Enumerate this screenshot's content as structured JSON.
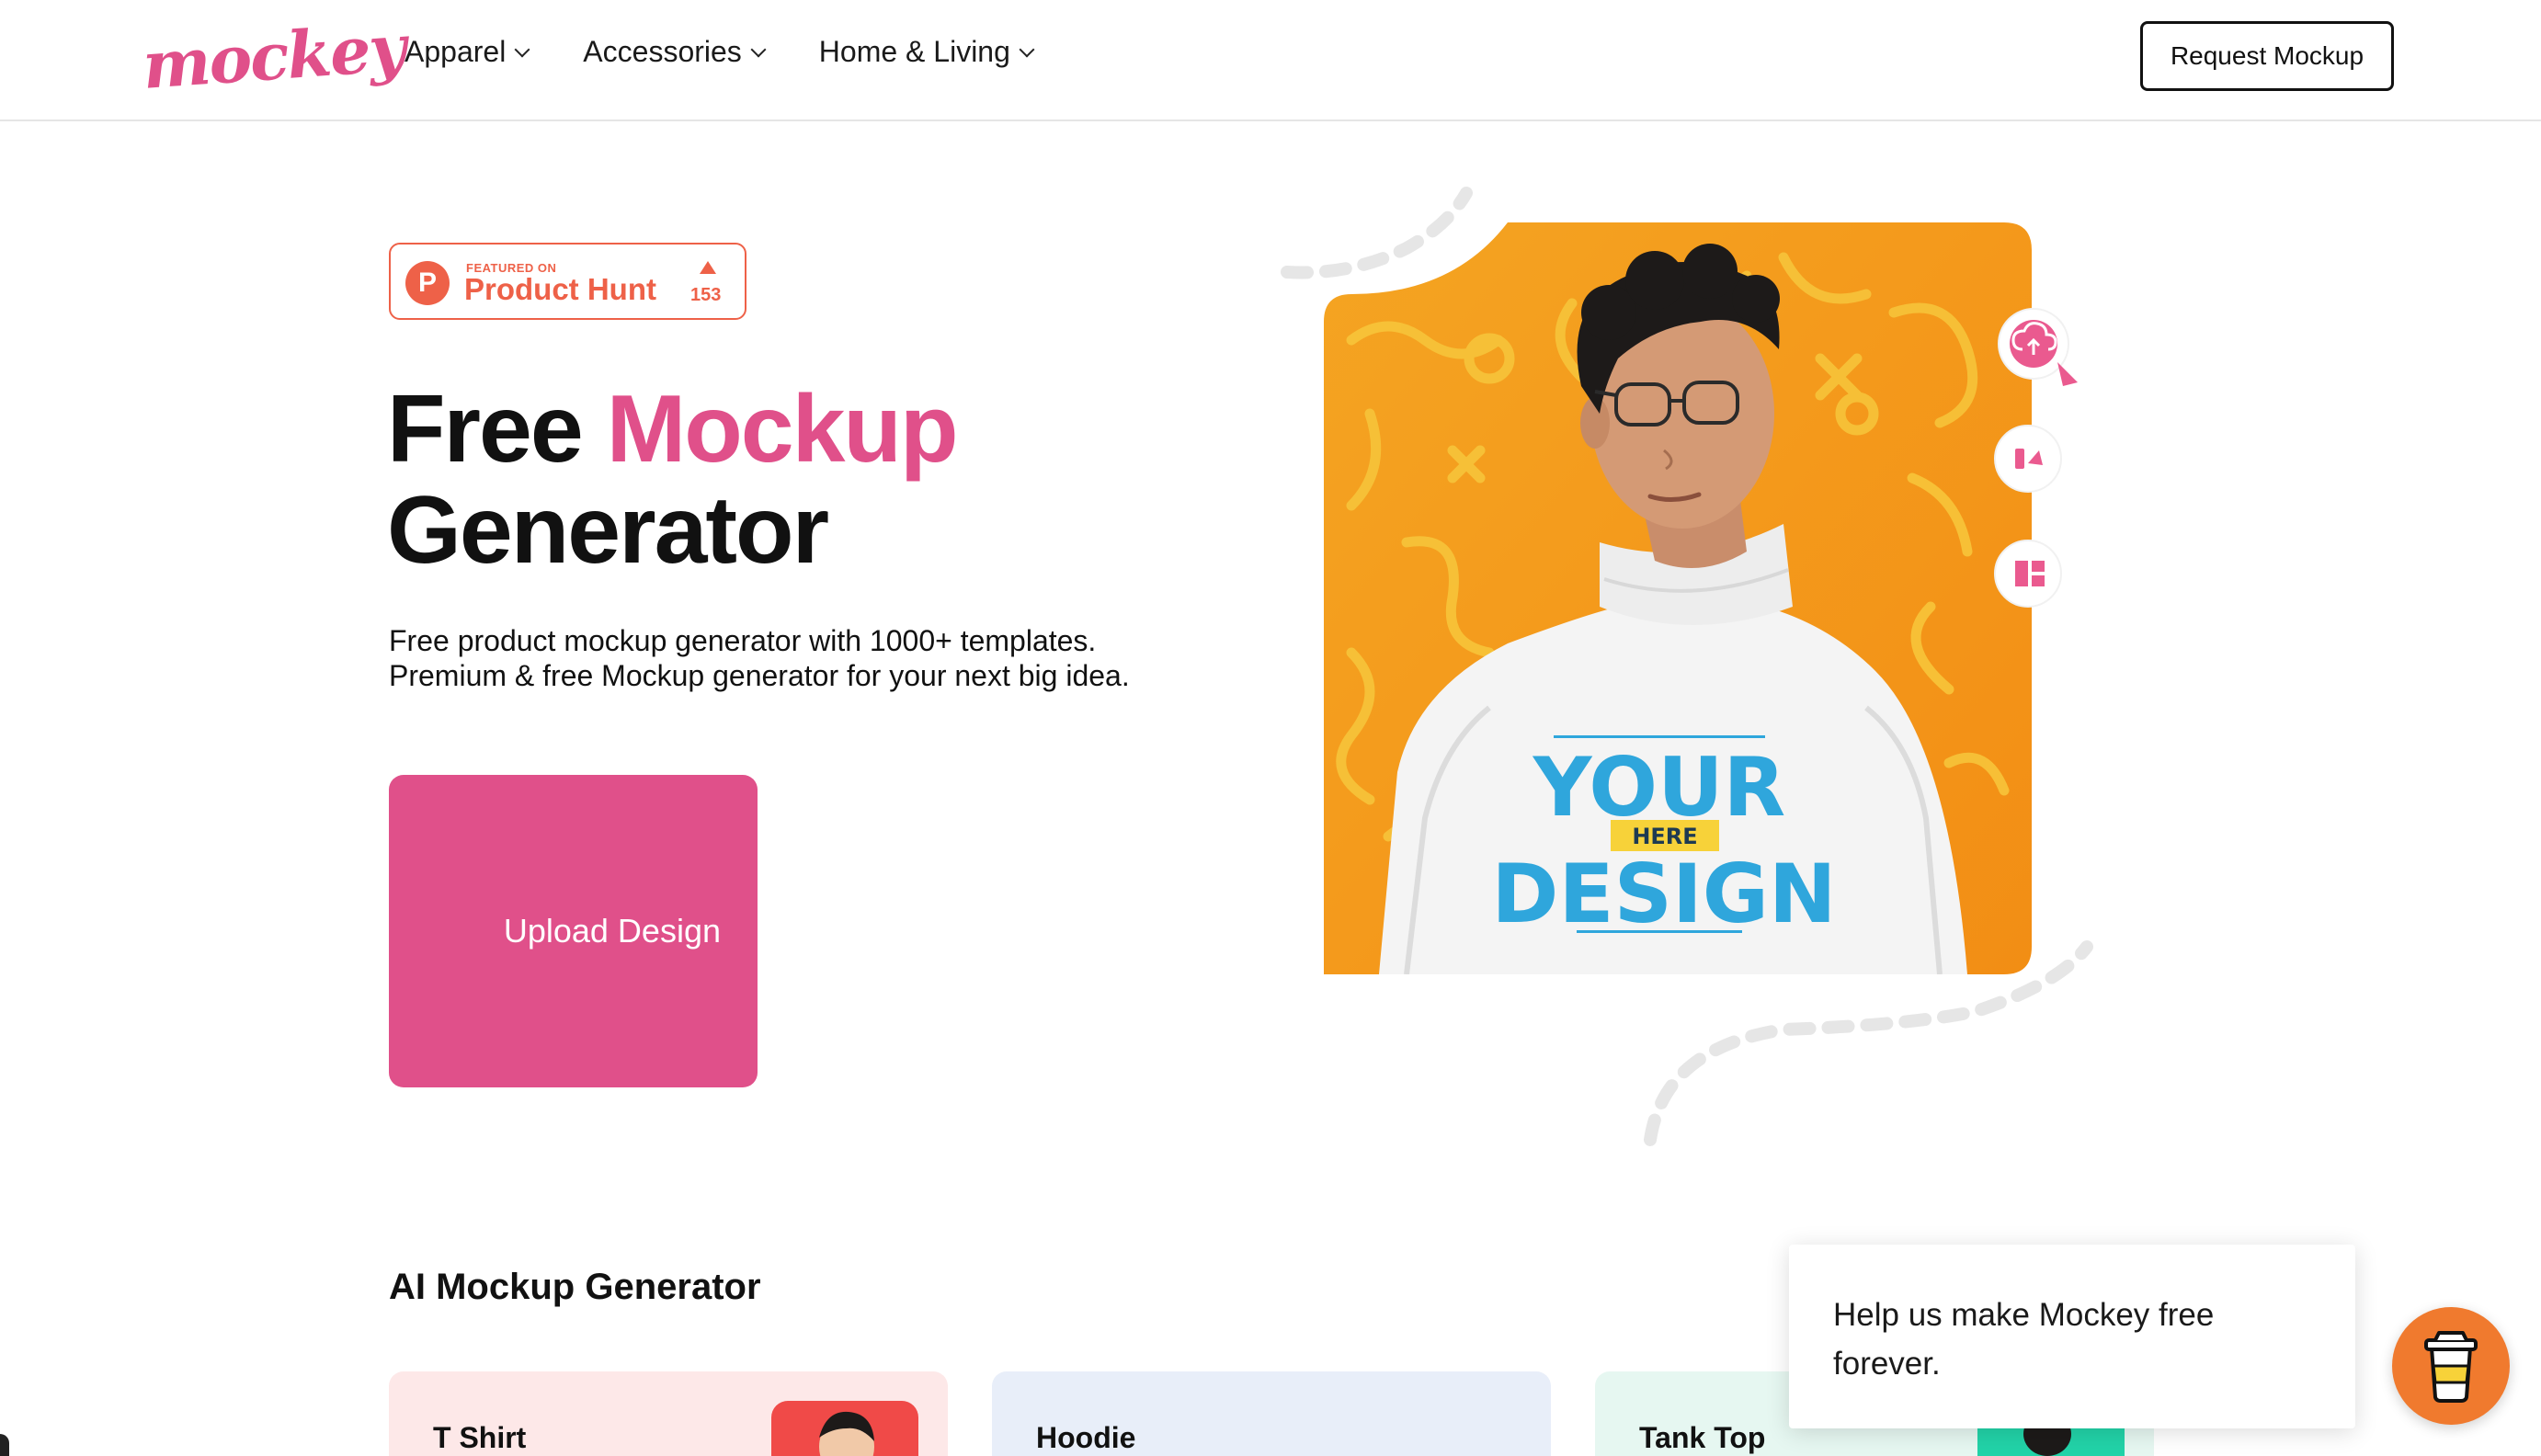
{
  "nav": {
    "logo_text": "mockey",
    "menu": [
      {
        "label": "Apparel"
      },
      {
        "label": "Accessories"
      },
      {
        "label": "Home & Living"
      }
    ],
    "request_button": "Request Mockup"
  },
  "hero": {
    "badge": {
      "featured_on": "FEATURED ON",
      "name": "Product Hunt",
      "logo_letter": "P",
      "upvotes": "153"
    },
    "title_part1": "Free ",
    "title_accent": "Mockup",
    "title_part2": "Generator",
    "description": "Free product mockup generator with 1000+ templates. Premium & free Mockup generator for your next big idea.",
    "upload_button": "Upload Design",
    "image": {
      "shirt_line1": "YOUR",
      "shirt_badge": "HERE",
      "shirt_line2": "DESIGN"
    }
  },
  "ai_section": {
    "title": "AI Mockup Generator",
    "cards": [
      {
        "label": "T Shirt"
      },
      {
        "label": "Hoodie"
      },
      {
        "label": "Tank Top"
      }
    ]
  },
  "support": {
    "message": "Help us make Mockey free forever."
  },
  "colors": {
    "brand_pink": "#e0508a",
    "product_hunt": "#ee6148",
    "hero_orange": "#f39a1c",
    "coffee_orange": "#f07a2e"
  },
  "icons": [
    "chevron-down-icon",
    "upload-cloud-icon",
    "cursor-icon",
    "brush-icon",
    "layout-icon",
    "coffee-cup-icon"
  ]
}
